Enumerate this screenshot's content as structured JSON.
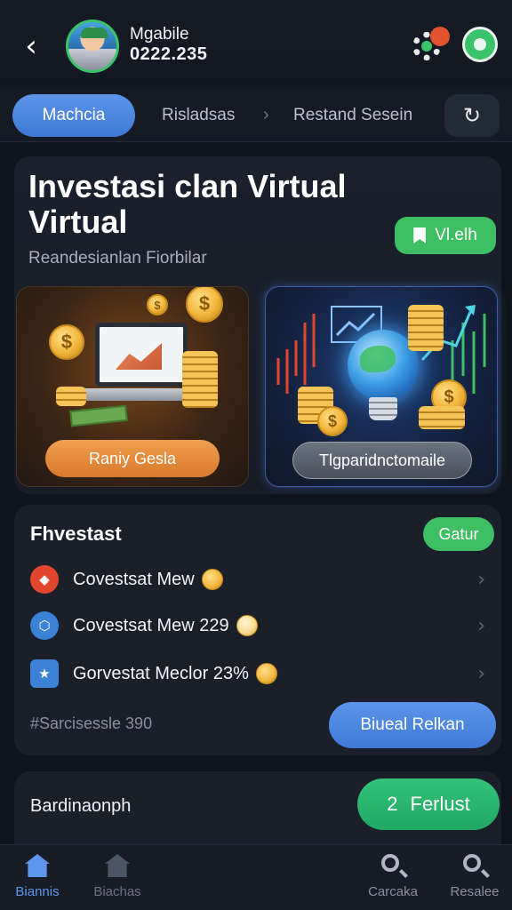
{
  "header": {
    "user_name": "Mgabile",
    "user_id": "0222.235",
    "notification_count": ""
  },
  "tabs": {
    "active": "Machcia",
    "items": [
      "Risladsas",
      "Restand Sesein"
    ]
  },
  "hero": {
    "title": "Investasi  clan Virtual Virtual",
    "subtitle": "Reandesianlan Fiorbilar",
    "view_button": "Vl.elh",
    "promo_left_button": "Raniy Gesla",
    "promo_right_button": "Tlgparidnctomaile"
  },
  "invest": {
    "title": "Fhvestast",
    "filter_button": "Gatur",
    "items": [
      {
        "label": "Covestsat  Mew",
        "icon_color": "#e2462f"
      },
      {
        "label": "Covestsat  Mew 229",
        "icon_color": "#3b82d6"
      },
      {
        "label": "Gorvestat  Meclor 23%",
        "icon_color": "#3b82d6"
      }
    ],
    "footer": "#Sarcisessle 390",
    "action_button": "Biueal Relkan"
  },
  "bottom_card": {
    "title": "Bardinaonph",
    "button_number": "2",
    "button_label": "Ferlust"
  },
  "nav": {
    "items": [
      {
        "label": "Biannis",
        "color": "#5d95ea"
      },
      {
        "label": "Biachas",
        "color": "#4b5566"
      },
      {
        "label": "Carcaka",
        "color": "#8a919e"
      },
      {
        "label": "Resalee",
        "color": "#8a919e"
      }
    ]
  },
  "colors": {
    "accent_blue": "#4a86e0",
    "accent_green": "#3fbf63",
    "background": "#0f131b"
  }
}
